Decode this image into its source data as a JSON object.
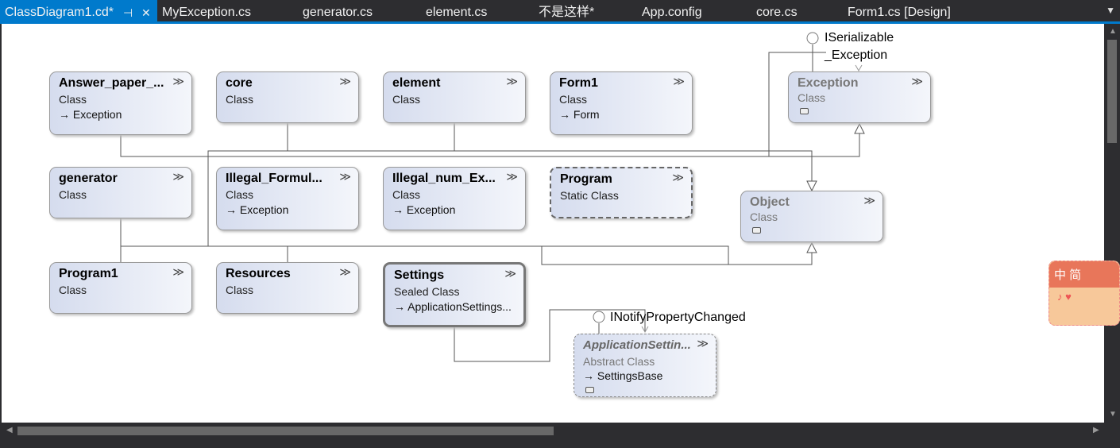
{
  "tabs": [
    {
      "label": "ClassDiagram1.cd*",
      "active": true
    },
    {
      "label": "MyException.cs"
    },
    {
      "label": "generator.cs"
    },
    {
      "label": "element.cs"
    },
    {
      "label": "不是这样*"
    },
    {
      "label": "App.config"
    },
    {
      "label": "core.cs"
    },
    {
      "label": "Form1.cs [Design]"
    }
  ],
  "tab_icons": {
    "pin": "⊣",
    "close": "✕"
  },
  "classes": [
    {
      "name": "Answer_paper_...",
      "kind": "Class",
      "base": "Exception"
    },
    {
      "name": "core",
      "kind": "Class"
    },
    {
      "name": "element",
      "kind": "Class"
    },
    {
      "name": "Form1",
      "kind": "Class",
      "base": "Form"
    },
    {
      "name": "Exception",
      "kind": "Class"
    },
    {
      "name": "generator",
      "kind": "Class"
    },
    {
      "name": "Illegal_Formul...",
      "kind": "Class",
      "base": "Exception"
    },
    {
      "name": "Illegal_num_Ex...",
      "kind": "Class",
      "base": "Exception"
    },
    {
      "name": "Program",
      "kind": "Static Class"
    },
    {
      "name": "Object",
      "kind": "Class"
    },
    {
      "name": "Program1",
      "kind": "Class"
    },
    {
      "name": "Resources",
      "kind": "Class"
    },
    {
      "name": "Settings",
      "kind": "Sealed Class",
      "base": "ApplicationSettings..."
    },
    {
      "name": "ApplicationSettin...",
      "kind": "Abstract Class",
      "base": "SettingsBase"
    }
  ],
  "interfaces": {
    "iserializable": "ISerializable",
    "exception": "_Exception",
    "inotify": "INotifyPropertyChanged"
  },
  "ime": {
    "text": "中 简"
  },
  "colors": {
    "accent": "#007acc",
    "chrome": "#2d2d30"
  }
}
